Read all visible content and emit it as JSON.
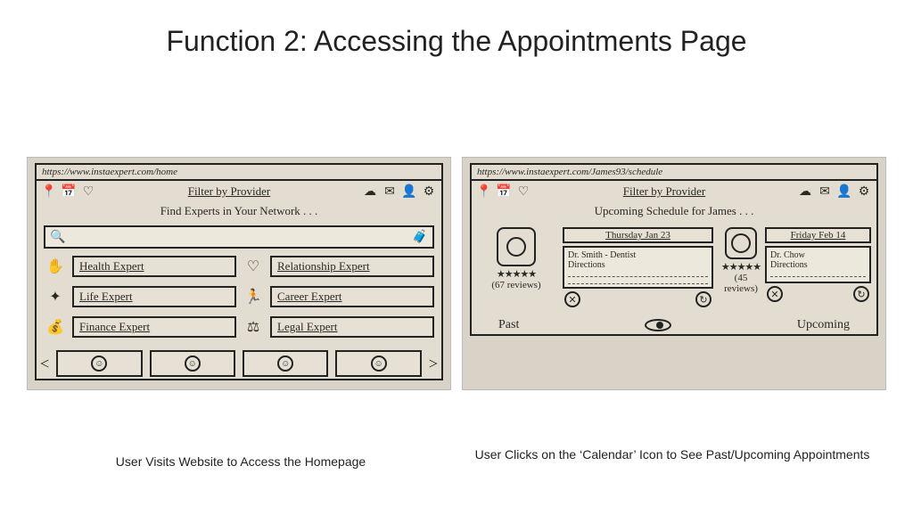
{
  "title": "Function 2: Accessing the Appointments Page",
  "left": {
    "url": "https://www.instaexpert.com/home",
    "filter": "Filter by Provider",
    "headline": "Find Experts in Your Network . . .",
    "cats": {
      "c1": "Health Expert",
      "c1i": "health-icon",
      "c2": "Relationship Expert",
      "c2i": "heart-icon",
      "c3": "Life Expert",
      "c3i": "life-icon",
      "c4": "Career Expert",
      "c4i": "career-icon",
      "c5": "Finance Expert",
      "c5i": "finance-icon",
      "c6": "Legal Expert",
      "c6i": "legal-icon"
    },
    "caption": "User Visits Website to Access the Homepage"
  },
  "right": {
    "url": "https://www.instaexpert.com/James93/schedule",
    "filter": "Filter by Provider",
    "headline": "Upcoming Schedule for James . . .",
    "prof1": {
      "stars": "★★★★★",
      "reviews": "(67 reviews)"
    },
    "prof2": {
      "stars": "★★★★★",
      "reviews": "(45 reviews)"
    },
    "appt1": {
      "date": "Thursday Jan 23",
      "title": "Dr. Smith - Dentist",
      "sub": "Directions"
    },
    "appt2": {
      "date": "Friday Feb 14",
      "title": "Dr. Chow",
      "sub": "Directions"
    },
    "past": "Past",
    "upcoming": "Upcoming",
    "caption": "User Clicks on the ‘Calendar’ Icon to See Past/Upcoming Appointments"
  }
}
